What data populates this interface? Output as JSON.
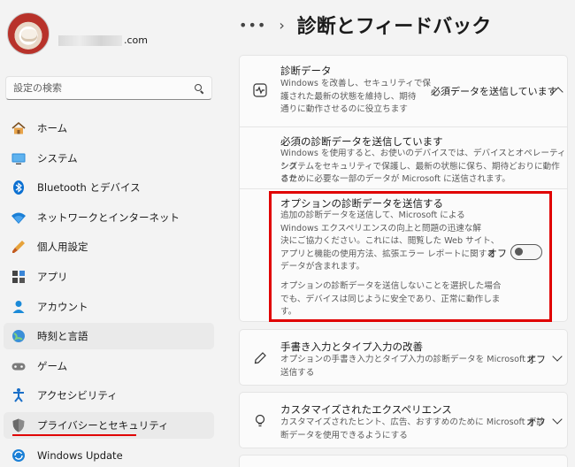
{
  "profile": {
    "email_domain": ".com"
  },
  "search": {
    "placeholder": "設定の検索"
  },
  "nav": {
    "items": [
      {
        "label": "ホーム"
      },
      {
        "label": "システム"
      },
      {
        "label": "Bluetooth とデバイス"
      },
      {
        "label": "ネットワークとインターネット"
      },
      {
        "label": "個人用設定"
      },
      {
        "label": "アプリ"
      },
      {
        "label": "アカウント"
      },
      {
        "label": "時刻と言語"
      },
      {
        "label": "ゲーム"
      },
      {
        "label": "アクセシビリティ"
      },
      {
        "label": "プライバシーとセキュリティ"
      },
      {
        "label": "Windows Update"
      }
    ]
  },
  "header": {
    "dots": "•••",
    "separator": "›",
    "title": "診断とフィードバック"
  },
  "diagnostic": {
    "title": "診断データ",
    "desc": [
      "Windows を改善し、セキュリティで保",
      "護された最新の状態を維持し、期待",
      "通りに動作させるのに役立ちます"
    ],
    "status": "必須データを送信しています",
    "required": {
      "title": "必須の診断データを送信しています",
      "desc": [
        "Windows を使用すると、お使いのデバイスでは、デバイスとオペレーティング",
        "システムをセキュリティで保護し、最新の状態に保ち、期待どおりに動作させ",
        "るために必要な一部のデータが Microsoft に送信されます。"
      ]
    },
    "optional": {
      "title": "オプションの診断データを送信する",
      "desc": [
        "追加の診断データを送信して、Microsoft による",
        "Windows エクスペリエンスの向上と問題の迅速な解",
        "決にご協力ください。これには、閲覧した Web サイト、",
        "アプリと機能の使用方法、拡張エラー レポートに関する",
        "データが含まれます。"
      ],
      "note": [
        "オプションの診断データを送信しないことを選択した場合",
        "でも、デバイスは同じように安全であり、正常に動作しま",
        "す。"
      ],
      "toggle_label": "オフ",
      "toggle_on": false
    }
  },
  "handwriting": {
    "title": "手書き入力とタイプ入力の改善",
    "desc": [
      "オプションの手書き入力とタイプ入力の診断データを Microsoft に",
      "送信する"
    ],
    "status": "オフ"
  },
  "tailored": {
    "title": "カスタマイズされたエクスペリエンス",
    "desc": [
      "カスタマイズされたヒント、広告、おすすめのために Microsoft が診",
      "断データを使用できるようにする"
    ],
    "status": "オフ"
  },
  "colors": {
    "accent": "#0067c0",
    "highlight": "#e00000"
  }
}
